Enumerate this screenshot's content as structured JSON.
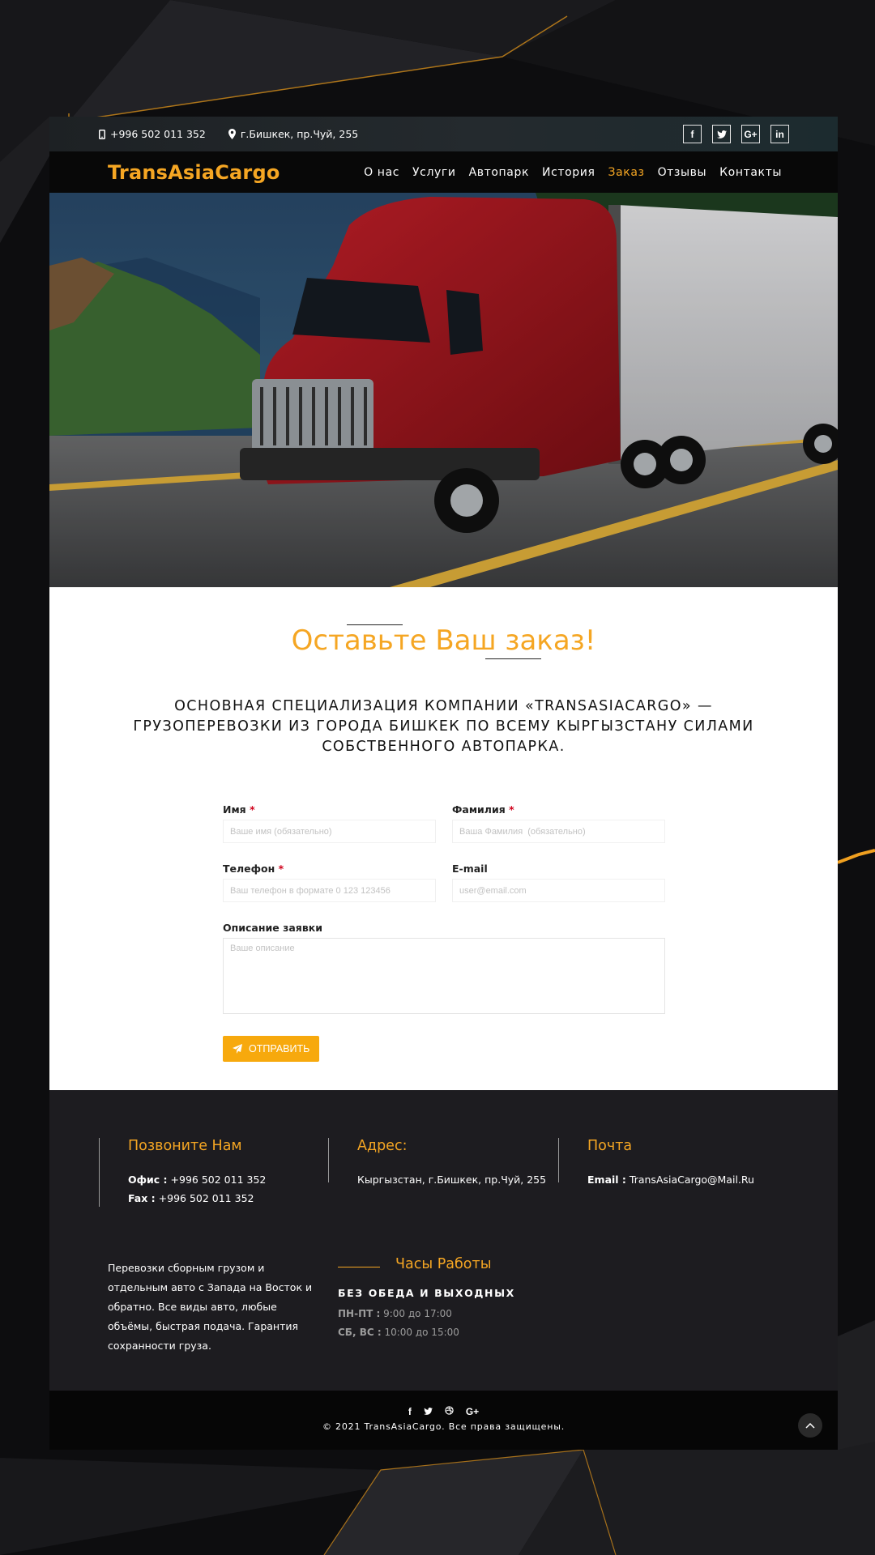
{
  "topbar": {
    "phone": "+996 502 011 352",
    "address": "г.Бишкек, пр.Чуй, 255",
    "socials": [
      {
        "icon": "facebook-icon",
        "glyph": "f"
      },
      {
        "icon": "twitter-icon",
        "glyph": "t"
      },
      {
        "icon": "google-plus-icon",
        "glyph": "G+"
      },
      {
        "icon": "linkedin-icon",
        "glyph": "in"
      }
    ]
  },
  "nav": {
    "logo": "TransAsiaCargo",
    "items": [
      {
        "label": "О нас",
        "active": false
      },
      {
        "label": "Услуги",
        "active": false
      },
      {
        "label": "Автопарк",
        "active": false
      },
      {
        "label": "История",
        "active": false
      },
      {
        "label": "Заказ",
        "active": true
      },
      {
        "label": "Отзывы",
        "active": false
      },
      {
        "label": "Контакты",
        "active": false
      }
    ]
  },
  "order": {
    "title": "Оставьте Ваш заказ!",
    "lead": "ОСНОВНАЯ СПЕЦИАЛИЗАЦИЯ КОМПАНИИ «TRANSASIACARGO» — ГРУЗОПЕРЕВОЗКИ ИЗ ГОРОДА БИШКЕК ПО ВСЕМУ КЫРГЫЗСТАНУ СИЛАМИ СОБСТВЕННОГО АВТОПАРКА.",
    "form": {
      "first_name_label": "Имя",
      "first_name_placeholder": "Ваше имя (обязательно)",
      "last_name_label": "Фамилия",
      "last_name_placeholder": "Ваша Фамилия  (обязательно)",
      "phone_label": "Телефон",
      "phone_placeholder": "Ваш телефон в формате 0 123 123456",
      "email_label": "E-mail",
      "email_placeholder": "user@email.com",
      "description_label": "Описание заявки",
      "description_placeholder": "Ваше описание",
      "required_mark": "*",
      "submit_label": "ОТПРАВИТЬ"
    }
  },
  "footer": {
    "call": {
      "title": "Позвоните Нам",
      "office_label": "Офис :",
      "office_value": "+996 502 011 352",
      "fax_label": "Fax :",
      "fax_value": "+996 502 011 352"
    },
    "address": {
      "title": "Адрес:",
      "value": "Кыргызстан, г.Бишкек, пр.Чуй, 255"
    },
    "mail": {
      "title": "Почта",
      "email_label": "Email :",
      "email_value": "TransAsiaCargo@Mail.Ru"
    },
    "about": "Перевозки сборным грузом и отдельным авто с Запада на Восток и обратно. Все виды авто, любые объёмы, быстрая подача. Гарантия сохранности груза.",
    "hours": {
      "title": "Часы Работы",
      "subtitle": "БЕЗ ОБЕДА И ВЫХОДНЫХ",
      "weekdays_label": "ПН-ПТ :",
      "weekdays_value": "9:00 до 17:00",
      "weekend_label": "СБ, ВС :",
      "weekend_value": "10:00 до 15:00"
    }
  },
  "bottom": {
    "copyright": "© 2021 TransAsiaCargo. Все права защищены.",
    "icons": [
      "facebook-icon",
      "twitter-icon",
      "dribbble-icon",
      "google-plus-icon"
    ]
  },
  "colors": {
    "accent": "#f5a623",
    "button": "#f7a90d",
    "dark": "#1d1c20"
  }
}
